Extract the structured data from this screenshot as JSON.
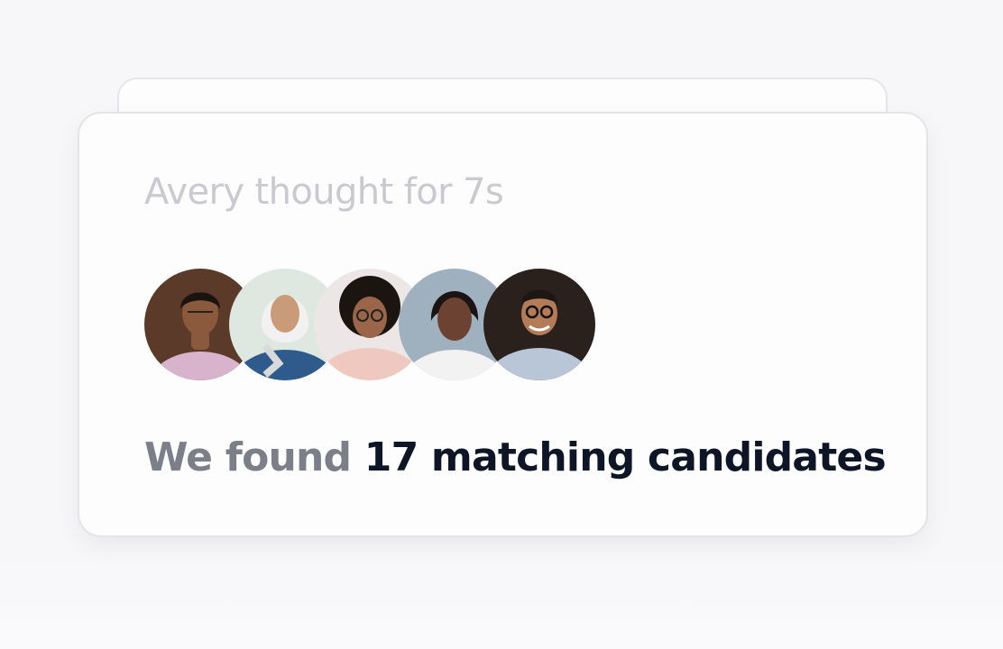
{
  "thinking_status": "Avery thought for 7s",
  "result": {
    "prefix": "We found",
    "highlight": "17 matching candidates"
  },
  "candidates": [
    {
      "icon": "person-photo",
      "bg": "#5c3a2a",
      "skin": "#8b5a3c",
      "hair": "#1a1410",
      "clothes": "#d8b4cc"
    },
    {
      "icon": "person-photo",
      "bg": "#dfe7e1",
      "skin": "#c99b78",
      "hair": "#f1f1f1",
      "clothes": "#2f5b8c"
    },
    {
      "icon": "person-photo",
      "bg": "#ece7e6",
      "skin": "#9a6548",
      "hair": "#1b1512",
      "clothes": "#efc9bf"
    },
    {
      "icon": "person-photo",
      "bg": "#9fb0be",
      "skin": "#6c4332",
      "hair": "#1a1412",
      "clothes": "#f2f2f2"
    },
    {
      "icon": "person-photo",
      "bg": "#2a211d",
      "skin": "#b47b58",
      "hair": "#1d1713",
      "clothes": "#b9c6d8"
    }
  ],
  "colors": {
    "muted_text": "#7b7f88",
    "strong_text": "#0d1526",
    "thinking_text": "#c9cad0",
    "card_border": "#e3e3e8"
  }
}
